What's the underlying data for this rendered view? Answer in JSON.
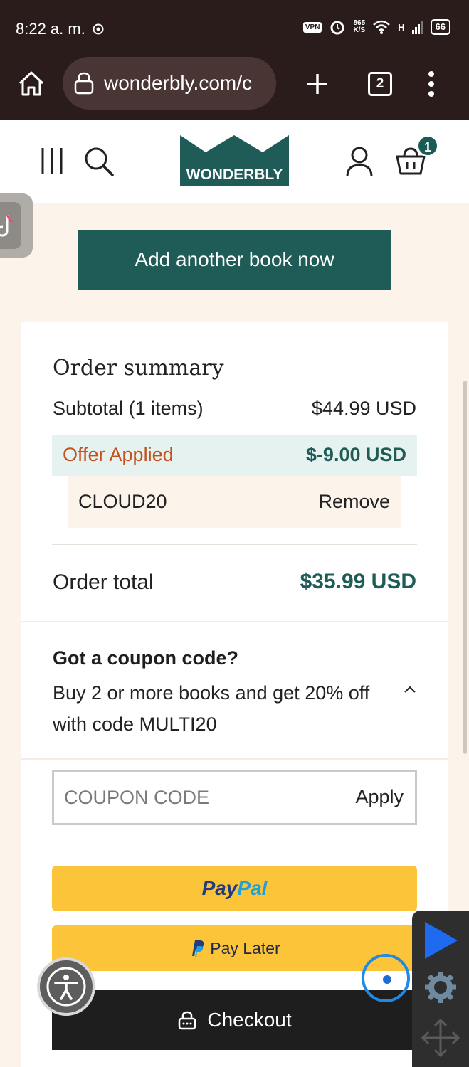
{
  "status_bar": {
    "time": "8:22 a. m.",
    "vpn": "VPN",
    "speed_value": "865",
    "speed_unit": "K/S",
    "network": "H",
    "battery": "66"
  },
  "browser": {
    "url": "wonderbly.com/c",
    "tab_count": "2"
  },
  "site_header": {
    "logo_text": "WONDERBLY",
    "cart_count": "1",
    "brand_color": "#1f5c57"
  },
  "add_book_button": "Add another book now",
  "order_summary": {
    "title": "Order summary",
    "subtotal_label": "Subtotal (1 items)",
    "subtotal_value": "$44.99 USD",
    "offer_label": "Offer Applied",
    "offer_value": "$-9.00 USD",
    "offer_code": "CLOUD20",
    "remove_label": "Remove",
    "total_label": "Order total",
    "total_value": "$35.99 USD"
  },
  "coupon": {
    "title": "Got a coupon code?",
    "description": "Buy 2 or more books and get 20% off with code MULTI20",
    "placeholder": "COUPON CODE",
    "value": "",
    "apply_label": "Apply"
  },
  "payment": {
    "paypal_pay": "Pay",
    "paypal_pal": "Pal",
    "pay_later_label": "Pay Later",
    "checkout_label": "Checkout"
  }
}
